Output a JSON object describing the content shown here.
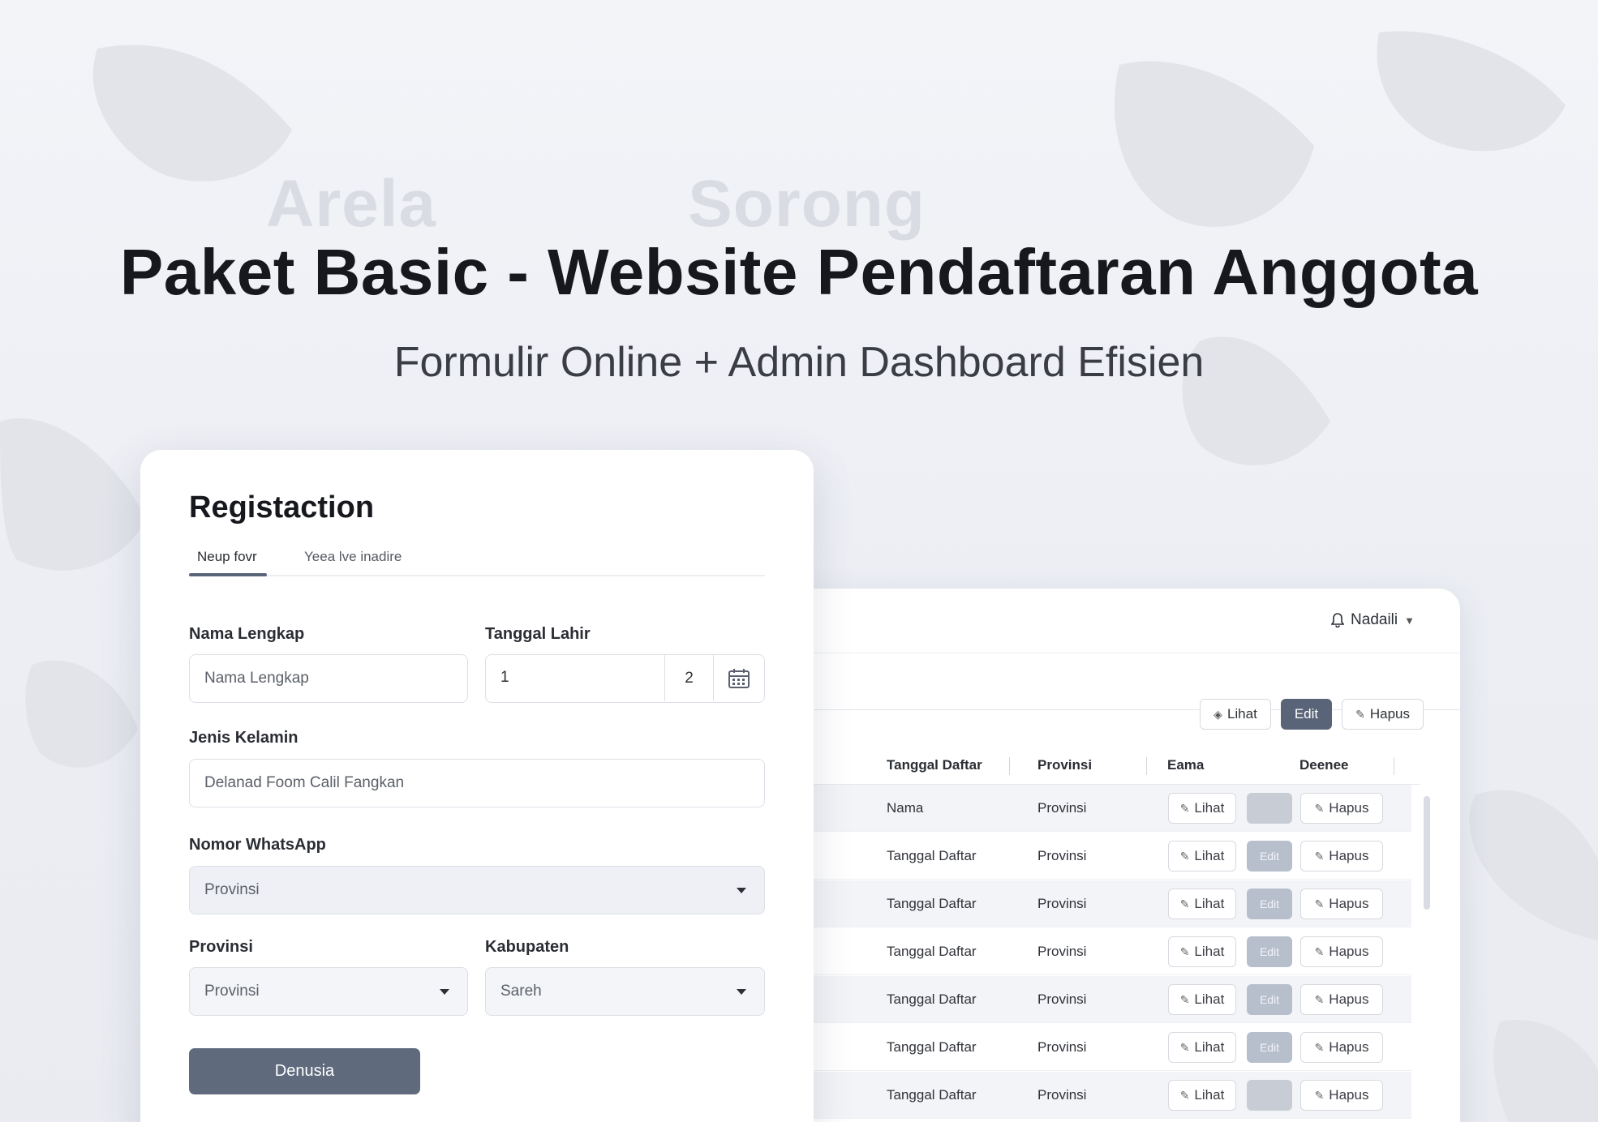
{
  "background": {
    "map_labels": [
      "Arela",
      "Sorong"
    ]
  },
  "hero": {
    "title": "Paket Basic - Website Pendaftaran Anggota",
    "subtitle": "Formulir Online + Admin Dashboard Efisien"
  },
  "registration": {
    "title": "Registaction",
    "tabs": [
      {
        "label": "Neup fovr",
        "active": true
      },
      {
        "label": "Yeea lve inadire",
        "active": false
      }
    ],
    "fields": {
      "nama_lengkap": {
        "label": "Nama Lengkap",
        "placeholder": "Nama Lengkap"
      },
      "tanggal_lahir": {
        "label": "Tanggal Lahir",
        "day": "1",
        "month": "2"
      },
      "jenis_kelamin": {
        "label": "Jenis Kelamin",
        "placeholder": "Delanad Foom Calil Fangkan"
      },
      "nomor_whatsapp": {
        "label": "Nomor WhatsApp",
        "value": "Provinsi"
      },
      "provinsi": {
        "label": "Provinsi",
        "value": "Provinsi"
      },
      "kabupaten": {
        "label": "Kabupaten",
        "value": "Sareh"
      }
    },
    "submit_label": "Denusia"
  },
  "admin": {
    "user_menu": "Nadaili",
    "bulk_actions": {
      "view": "Lihat",
      "edit": "Edit",
      "delete": "Hapus"
    },
    "table": {
      "columns": [
        "Tanggal Daftar",
        "Provinsi",
        "Eama",
        "Deenee"
      ],
      "rows": [
        {
          "tanggal": "Nama",
          "provinsi": "Provinsi",
          "view": "Lihat",
          "edit": "",
          "delete": "Hapus"
        },
        {
          "tanggal": "Tanggal Daftar",
          "provinsi": "Provinsi",
          "view": "Lihat",
          "edit": "Edit",
          "delete": "Hapus"
        },
        {
          "tanggal": "Tanggal Daftar",
          "provinsi": "Provinsi",
          "view": "Lihat",
          "edit": "Edit",
          "delete": "Hapus"
        },
        {
          "tanggal": "Tanggal Daftar",
          "provinsi": "Provinsi",
          "view": "Lihat",
          "edit": "Edit",
          "delete": "Hapus"
        },
        {
          "tanggal": "Tanggal Daftar",
          "provinsi": "Provinsi",
          "view": "Lihat",
          "edit": "Edit",
          "delete": "Hapus"
        },
        {
          "tanggal": "Tanggal Daftar",
          "provinsi": "Provinsi",
          "view": "Lihat",
          "edit": "Edit",
          "delete": "Hapus"
        },
        {
          "tanggal": "Tanggal Daftar",
          "provinsi": "Provinsi",
          "view": "Lihat",
          "edit": "",
          "delete": "Hapus"
        }
      ]
    }
  }
}
